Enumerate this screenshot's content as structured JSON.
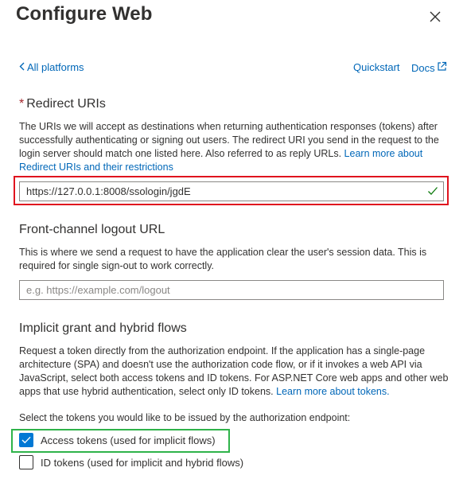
{
  "panel": {
    "title": "Configure Web",
    "close_icon": "close-icon"
  },
  "nav": {
    "back_label": "All platforms",
    "quickstart_label": "Quickstart",
    "docs_label": "Docs"
  },
  "redirect": {
    "required_marker": "*",
    "heading": "Redirect URIs",
    "description": "The URIs we will accept as destinations when returning authentication responses (tokens) after successfully authenticating or signing out users. The redirect URI you send in the request to the login server should match one listed here. Also referred to as reply URLs.",
    "learn_more_label": "Learn more about Redirect URIs and their restrictions",
    "uri_value": "https://127.0.0.1:8008/ssologin/jgdE",
    "valid_icon": "checkmark-icon"
  },
  "logout": {
    "heading": "Front-channel logout URL",
    "description": "This is where we send a request to have the application clear the user's session data. This is required for single sign-out to work correctly.",
    "placeholder": "e.g. https://example.com/logout"
  },
  "implicit": {
    "heading": "Implicit grant and hybrid flows",
    "description": "Request a token directly from the authorization endpoint. If the application has a single-page architecture (SPA) and doesn't use the authorization code flow, or if it invokes a web API via JavaScript, select both access tokens and ID tokens. For ASP.NET Core web apps and other web apps that use hybrid authentication, select only ID tokens.",
    "learn_more_label": "Learn more about tokens.",
    "select_prompt": "Select the tokens you would like to be issued by the authorization endpoint:",
    "access_tokens_label": "Access tokens (used for implicit flows)",
    "access_tokens_checked": true,
    "id_tokens_label": "ID tokens (used for implicit and hybrid flows)",
    "id_tokens_checked": false
  },
  "colors": {
    "link": "#0067b8",
    "checkbox_checked": "#0078d4",
    "highlight_red": "#e0141e",
    "highlight_green": "#2fb34a",
    "valid_green": "#107c10",
    "required_red": "#a4262c"
  }
}
